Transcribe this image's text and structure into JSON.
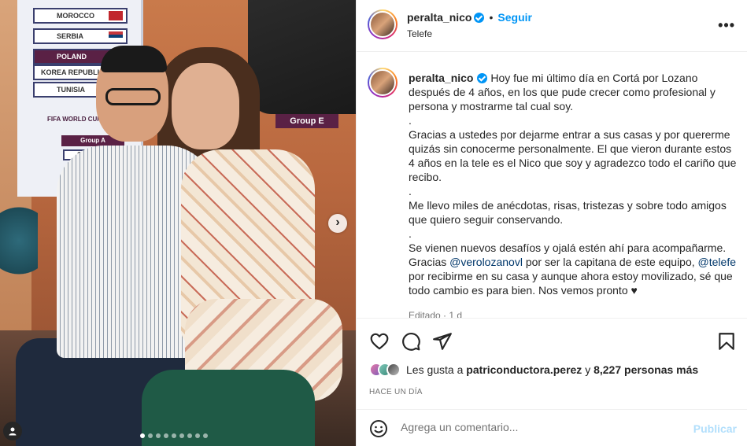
{
  "photo": {
    "board_rows": [
      "MOROCCO",
      "SERBIA",
      "POLAND",
      "KOREA REPUBLIC",
      "TUNISIA"
    ],
    "board_title": "FIFA WORLD CUP",
    "group_a": "Group A",
    "group_a_team": "QAT",
    "group_e": "Group E",
    "carousel_total": 9,
    "carousel_active": 1
  },
  "header": {
    "username": "peralta_nico",
    "follow_label": "Seguir",
    "separator": "•",
    "location": "Telefe",
    "more_label": "•••"
  },
  "caption": {
    "username": "peralta_nico",
    "p1": "Hoy fue mi último día en Cortá por Lozano después de 4 años, en los que pude crecer como profesional y persona y mostrarme tal cual soy.",
    "dot1": ".",
    "p2": "Gracias a ustedes por dejarme entrar a sus casas y por quererme quizás sin conocerme personalmente. El que vieron durante estos 4 años en la tele es el Nico que soy y agradezco todo el cariño que recibo.",
    "dot2": ".",
    "p3": "Me llevo miles de anécdotas, risas, tristezas y sobre todo amigos que quiero seguir conservando.",
    "dot3": ".",
    "p4a": "Se vienen nuevos desafíos y ojalá estén ahí para acompañarme. Gracias ",
    "mention1": "@verolozanovl",
    "p4b": " por ser la capitana de este equipo, ",
    "mention2": "@telefe",
    "p4c": " por recibirme en su casa y aunque ahora estoy movilizado, sé que todo cambio es para bien. Nos vemos pronto ♥",
    "edited": "Editado · 1 d"
  },
  "likes": {
    "prefix": "Les gusta a ",
    "user": "patriconductora.perez",
    "middle": " y ",
    "count": "8,227 personas más"
  },
  "timeago": "HACE UN DÍA",
  "comment": {
    "placeholder": "Agrega un comentario...",
    "publish_label": "Publicar"
  },
  "colors": {
    "accent": "#0095f6",
    "publish_disabled": "#b2dffc",
    "mention": "#00376b"
  }
}
